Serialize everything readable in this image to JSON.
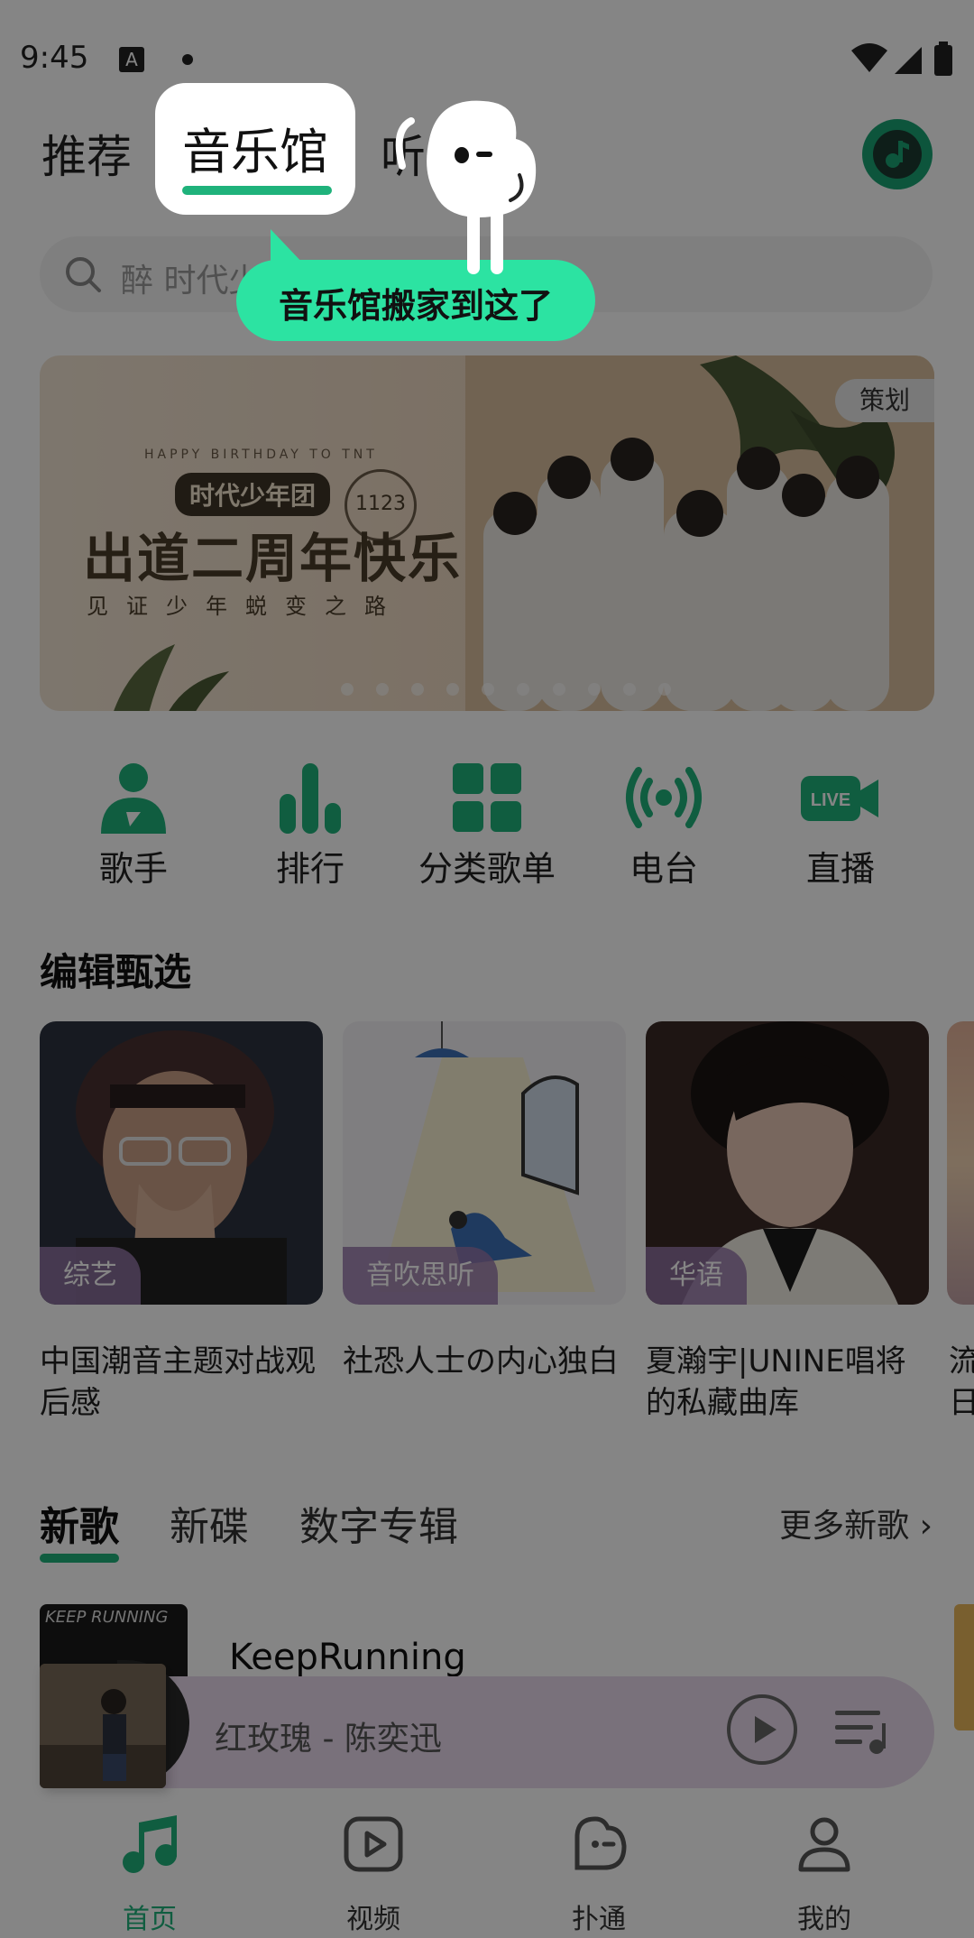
{
  "status_bar": {
    "time": "9:45",
    "a_icon": "A"
  },
  "top_tabs": {
    "recommend": "推荐",
    "music_hall": "音乐馆",
    "listen_partial": "听"
  },
  "tooltip": {
    "text": "音乐馆搬家到这了"
  },
  "search": {
    "placeholder": "醉 时代少"
  },
  "banner": {
    "tag": "策划",
    "subtitle": "HAPPY BIRTHDAY TO TNT",
    "group_name": "时代少年团",
    "stamp": "1123",
    "title": "出道二周年快乐",
    "caption": "见证少年蜕变之路"
  },
  "categories": [
    {
      "label": "歌手",
      "icon": "singer-icon"
    },
    {
      "label": "排行",
      "icon": "chart-icon"
    },
    {
      "label": "分类歌单",
      "icon": "grid-icon"
    },
    {
      "label": "电台",
      "icon": "radio-icon"
    },
    {
      "label": "直播",
      "icon": "live-icon"
    }
  ],
  "live_icon_text": "LIVE",
  "editors_pick": {
    "title": "编辑甄选",
    "cards": [
      {
        "tag": "综艺",
        "title": "中国潮音主题对战观后感"
      },
      {
        "tag": "音吹思听",
        "title": "社恐人士の内心独白"
      },
      {
        "tag": "华语",
        "title": "夏瀚宇|UNINE唱将的私藏曲库"
      }
    ],
    "partial_title": "流日"
  },
  "new_tabs": {
    "new_songs": "新歌",
    "new_albums": "新碟",
    "digital_albums": "数字专辑",
    "more": "更多新歌"
  },
  "song": {
    "title": "KeepRunning",
    "cover_text": "KEEP RUNNING"
  },
  "player": {
    "now_playing": "红玫瑰 - 陈奕迅"
  },
  "bottom_nav": [
    {
      "label": "首页",
      "icon": "music-note-icon",
      "active": true
    },
    {
      "label": "视频",
      "icon": "video-icon",
      "active": false
    },
    {
      "label": "扑通",
      "icon": "face-icon",
      "active": false
    },
    {
      "label": "我的",
      "icon": "user-icon",
      "active": false
    }
  ],
  "colors": {
    "accent": "#1fb27b",
    "tooltip": "#2ce3a2",
    "overlay": "rgba(0,0,0,0.48)"
  }
}
